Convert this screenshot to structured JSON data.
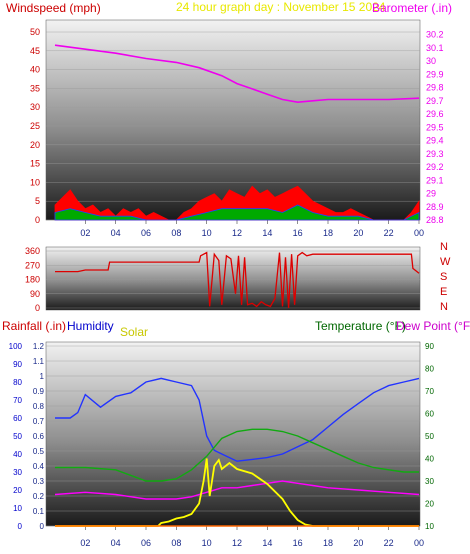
{
  "header": {
    "windspeed_label": "Windspeed (mph)",
    "title": "24 hour graph day : November 15 2024",
    "barometer_label": "Barometer (.in)"
  },
  "bottom_header": {
    "rainfall_label": "Rainfall (.in)",
    "humidity_label": "Humidity",
    "solar_label": "Solar",
    "temperature_label": "Temperature (°F)",
    "dewpoint_label": "Dew Point (°F)"
  },
  "colors": {
    "red_label": "#cc0000",
    "title_yellow": "#e8e800",
    "barometer": "#ee00ee",
    "humidity": "#0000cc",
    "solar": "#c8c800",
    "temperature": "#006600",
    "dewpoint": "#cc00cc",
    "wind_avg": "#2040ff",
    "wind_green": "#00aa00",
    "wind_gust": "#ff0000",
    "direction_line": "#dd0000",
    "bottom_temp_line": "#11aa11",
    "bottom_hum_line": "#2233ff",
    "bottom_dew_line": "#ff00ff",
    "bottom_solar_line": "#ffff00"
  },
  "chart_data": [
    {
      "id": "wind_barometer",
      "type": "line",
      "x_unit": "hour",
      "x_ticks": [
        "02",
        "04",
        "06",
        "08",
        "10",
        "12",
        "14",
        "16",
        "18",
        "20",
        "22",
        "00"
      ],
      "y_left": {
        "label": "Windspeed (mph)",
        "ticks": [
          "0",
          "5",
          "10",
          "15",
          "20",
          "25",
          "30",
          "35",
          "40",
          "45",
          "50"
        ],
        "ylim": [
          0,
          50
        ]
      },
      "y_right": {
        "label": "Barometer (.in)",
        "ticks": [
          "28.8",
          "28.9",
          "29",
          "29.1",
          "29.2",
          "29.3",
          "29.4",
          "29.5",
          "29.6",
          "29.7",
          "29.8",
          "29.9",
          "30",
          "30.1",
          "30.2"
        ],
        "ylim": [
          28.8,
          30.25
        ]
      },
      "series": [
        {
          "name": "Barometer (.in)",
          "axis": "right",
          "x": [
            0,
            2,
            4,
            6,
            8,
            9.5,
            11,
            12,
            13,
            14,
            15,
            16,
            17,
            18,
            20,
            22,
            24
          ],
          "y": [
            30.12,
            30.09,
            30.06,
            30.02,
            29.99,
            29.95,
            29.89,
            29.83,
            29.79,
            29.75,
            29.71,
            29.69,
            29.7,
            29.71,
            29.71,
            29.71,
            29.72
          ]
        },
        {
          "name": "Wind gust",
          "axis": "left",
          "x": [
            0,
            0.5,
            1,
            1.5,
            2,
            2.5,
            3,
            3.5,
            4,
            4.5,
            5,
            5.5,
            6,
            6.5,
            7,
            7.5,
            8,
            8.5,
            9,
            9.5,
            10,
            10.5,
            11,
            11.5,
            12,
            12.5,
            13,
            13.5,
            14,
            14.5,
            15,
            15.5,
            16,
            16.5,
            17,
            17.5,
            18,
            18.5,
            19,
            19.5,
            20,
            20.5,
            21,
            21.5,
            22,
            22.5,
            23,
            23.5,
            24
          ],
          "y": [
            4,
            6,
            8,
            5,
            3,
            4,
            2,
            3,
            1,
            3,
            2,
            3,
            1,
            2,
            1,
            0,
            0,
            2,
            3,
            5,
            6,
            7,
            5,
            8,
            7,
            6,
            9,
            7,
            8,
            6,
            7,
            8,
            9,
            7,
            5,
            4,
            3,
            2,
            2,
            3,
            2,
            1,
            0,
            0,
            0,
            0,
            0,
            2,
            5
          ]
        },
        {
          "name": "Wind average",
          "axis": "left",
          "x": [
            0,
            1,
            2,
            3,
            4,
            5,
            6,
            7,
            8,
            9,
            10,
            11,
            12,
            13,
            14,
            15,
            16,
            17,
            18,
            19,
            20,
            21,
            22,
            23,
            24
          ],
          "y": [
            2,
            3,
            2,
            1,
            1,
            1,
            0,
            0,
            0,
            1,
            2,
            3,
            3,
            3,
            3,
            2,
            4,
            2,
            1,
            1,
            1,
            0,
            0,
            0,
            2
          ]
        }
      ]
    },
    {
      "id": "wind_direction",
      "type": "line",
      "x_unit": "hour",
      "y_ticks": [
        "0",
        "90",
        "180",
        "270",
        "360"
      ],
      "ylim": [
        0,
        360
      ],
      "direction_labels": [
        "N",
        "W",
        "S",
        "E",
        "N"
      ],
      "series": [
        {
          "name": "Wind direction",
          "x": [
            0,
            1.5,
            2,
            3.5,
            3.6,
            9.5,
            9.6,
            10.0,
            10.2,
            10.5,
            10.8,
            11.0,
            11.3,
            11.6,
            11.9,
            12.1,
            12.3,
            12.5,
            12.7,
            13.0,
            13.3,
            13.6,
            13.9,
            14.2,
            14.5,
            14.8,
            15.0,
            15.2,
            15.4,
            15.6,
            15.8,
            16.0,
            16.3,
            16.6,
            17.0,
            23.5,
            23.6,
            24
          ],
          "y": [
            230,
            230,
            240,
            240,
            290,
            290,
            330,
            350,
            10,
            340,
            300,
            20,
            330,
            310,
            90,
            330,
            20,
            320,
            20,
            30,
            10,
            40,
            20,
            10,
            60,
            350,
            10,
            320,
            0,
            340,
            20,
            330,
            350,
            330,
            340,
            340,
            250,
            220
          ]
        }
      ]
    },
    {
      "id": "rain_hum_solar_temp",
      "type": "line",
      "x_unit": "hour",
      "y_rain": {
        "label": "Rainfall (.in)",
        "ticks": [
          "0",
          "0.1",
          "0.2",
          "0.3",
          "0.4",
          "0.5",
          "0.6",
          "0.7",
          "0.8",
          "0.9",
          "1",
          "1.1",
          "1.2"
        ],
        "ylim": [
          0,
          1.2
        ]
      },
      "y_hum": {
        "label": "Humidity",
        "ticks": [
          "0",
          "10",
          "20",
          "30",
          "40",
          "50",
          "60",
          "70",
          "80",
          "90",
          "100"
        ],
        "ylim": [
          0,
          100
        ]
      },
      "y_temp": {
        "label": "Temperature (°F)",
        "ticks": [
          "10",
          "20",
          "30",
          "40",
          "50",
          "60",
          "70",
          "80",
          "90"
        ],
        "ylim": [
          10,
          90
        ]
      },
      "series": [
        {
          "name": "Humidity",
          "axis": "hum",
          "x": [
            0,
            1,
            1.5,
            2,
            3,
            4,
            5,
            6,
            7,
            8,
            9,
            9.5,
            10,
            10.5,
            11,
            12,
            13,
            14,
            15,
            16,
            17,
            18,
            19,
            20,
            21,
            22,
            23,
            24
          ],
          "y": [
            60,
            60,
            63,
            73,
            66,
            72,
            74,
            80,
            82,
            80,
            78,
            70,
            50,
            42,
            40,
            36,
            37,
            38,
            40,
            44,
            48,
            55,
            62,
            68,
            74,
            78,
            80,
            82
          ]
        },
        {
          "name": "Temperature (°F)",
          "axis": "temp",
          "x": [
            0,
            2,
            4,
            6,
            7,
            8,
            9,
            10,
            11,
            12,
            13,
            14,
            15,
            16,
            17,
            18,
            19,
            20,
            21,
            22,
            23,
            24
          ],
          "y": [
            36,
            36,
            35,
            30,
            30,
            31,
            35,
            41,
            49,
            52,
            53,
            53,
            52,
            50,
            47,
            44,
            41,
            38,
            36,
            35,
            34,
            34
          ]
        },
        {
          "name": "Dew Point (°F)",
          "axis": "temp",
          "x": [
            0,
            2,
            4,
            6,
            8,
            9,
            10,
            11,
            12,
            13,
            14,
            15,
            16,
            17,
            18,
            20,
            22,
            24
          ],
          "y": [
            24,
            25,
            24,
            22,
            22,
            23,
            25,
            27,
            27,
            28,
            29,
            30,
            29,
            28,
            27,
            26,
            25,
            24
          ]
        },
        {
          "name": "Solar",
          "axis": "rain",
          "x": [
            0,
            6.8,
            7,
            7.5,
            8,
            8.5,
            9,
            9.5,
            9.8,
            10.0,
            10.2,
            10.5,
            10.8,
            11,
            11.5,
            12,
            13,
            14,
            15,
            15.5,
            16,
            16.5,
            17,
            24
          ],
          "y": [
            0,
            0,
            0.02,
            0.03,
            0.05,
            0.06,
            0.08,
            0.15,
            0.3,
            0.45,
            0.2,
            0.4,
            0.44,
            0.38,
            0.42,
            0.38,
            0.35,
            0.28,
            0.18,
            0.1,
            0.04,
            0.01,
            0,
            0
          ]
        },
        {
          "name": "Rainfall (.in)",
          "axis": "rain",
          "x": [
            0,
            24
          ],
          "y": [
            0,
            0
          ]
        }
      ]
    }
  ]
}
